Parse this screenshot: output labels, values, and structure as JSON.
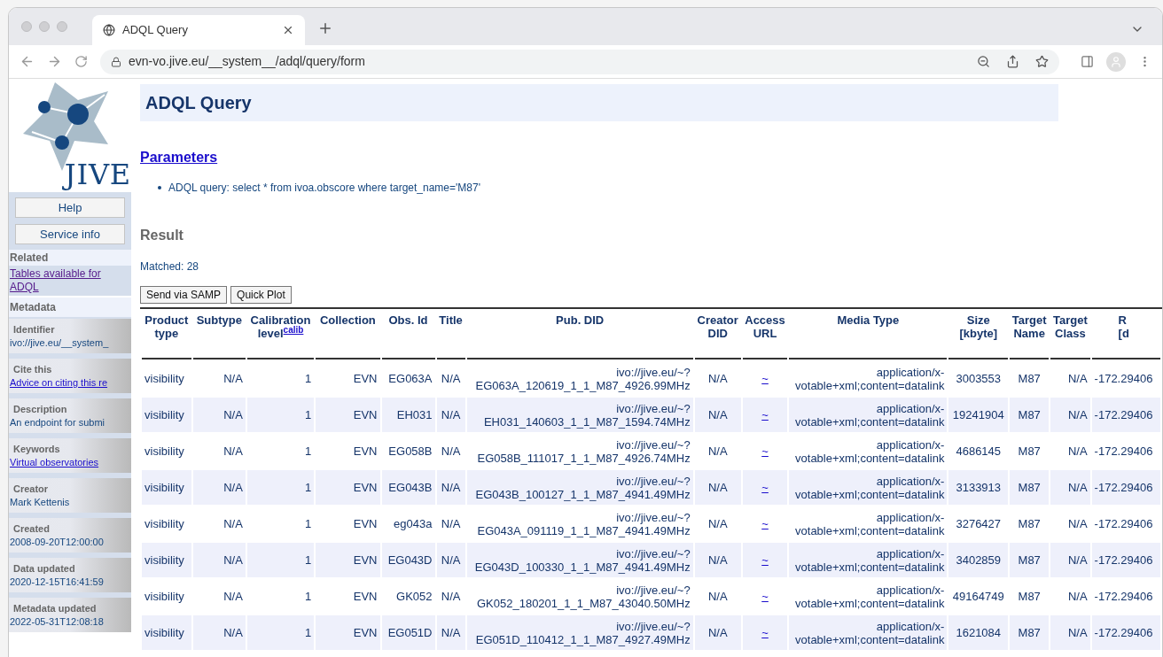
{
  "browser": {
    "tab_title": "ADQL Query",
    "url": "evn-vo.jive.eu/__system__/adql/query/form"
  },
  "sidebar": {
    "logo_text": "JIVE",
    "buttons": [
      "Help",
      "Service info"
    ],
    "related": {
      "heading": "Related",
      "links": [
        "Tables available for ADQL"
      ]
    },
    "metadata": {
      "heading": "Metadata",
      "items": [
        {
          "label": "Identifier",
          "value": "ivo://jive.eu/__system_",
          "kind": "text"
        },
        {
          "label": "Cite this",
          "value": "Advice on citing this re",
          "kind": "link"
        },
        {
          "label": "Description",
          "value": "An endpoint for submi",
          "kind": "text"
        },
        {
          "label": "Keywords",
          "value": "Virtual observatories",
          "kind": "link"
        },
        {
          "label": "Creator",
          "value": "Mark Kettenis",
          "kind": "text"
        },
        {
          "label": "Created",
          "value": "2008-09-20T12:00:00",
          "kind": "text"
        },
        {
          "label": "Data updated",
          "value": "2020-12-15T16:41:59",
          "kind": "text"
        },
        {
          "label": "Metadata updated",
          "value": "2022-05-31T12:08:18",
          "kind": "text"
        }
      ]
    }
  },
  "main": {
    "title": "ADQL Query",
    "parameters": {
      "heading": "Parameters",
      "items": [
        "ADQL query: select * from ivoa.obscore where target_name='M87'"
      ]
    },
    "result": {
      "heading": "Result",
      "matched": "Matched: 28",
      "buttons": [
        "Send via SAMP",
        "Quick Plot"
      ]
    },
    "table": {
      "columns": [
        {
          "lines": [
            "Product",
            "type"
          ]
        },
        {
          "lines": [
            "Subtype"
          ]
        },
        {
          "lines": [
            "Calibration",
            "level"
          ],
          "note": "calib"
        },
        {
          "lines": [
            "Collection"
          ]
        },
        {
          "lines": [
            "Obs. Id"
          ]
        },
        {
          "lines": [
            "Title"
          ]
        },
        {
          "lines": [
            "Pub. DID"
          ]
        },
        {
          "lines": [
            "Creator",
            "DID"
          ]
        },
        {
          "lines": [
            "Access",
            "URL"
          ]
        },
        {
          "lines": [
            "Media Type"
          ]
        },
        {
          "lines": [
            "Size",
            "[kbyte]"
          ]
        },
        {
          "lines": [
            "Target",
            "Name"
          ]
        },
        {
          "lines": [
            "Target",
            "Class"
          ]
        },
        {
          "lines": [
            "R",
            "[d"
          ]
        }
      ],
      "rows": [
        [
          "visibility",
          "N/A",
          "1",
          "EVN",
          "EG063A",
          "N/A",
          [
            "ivo://jive.eu/~?",
            "EG063A_120619_1_1_M87_4926.99MHz"
          ],
          "N/A",
          "~",
          "application/x-votable+xml;content=datalink",
          "3003553",
          "M87",
          "N/A",
          "-172.29406"
        ],
        [
          "visibility",
          "N/A",
          "1",
          "EVN",
          "EH031",
          "N/A",
          [
            "ivo://jive.eu/~?",
            "EH031_140603_1_1_M87_1594.74MHz"
          ],
          "N/A",
          "~",
          "application/x-votable+xml;content=datalink",
          "19241904",
          "M87",
          "N/A",
          "-172.29406"
        ],
        [
          "visibility",
          "N/A",
          "1",
          "EVN",
          "EG058B",
          "N/A",
          [
            "ivo://jive.eu/~?",
            "EG058B_111017_1_1_M87_4926.74MHz"
          ],
          "N/A",
          "~",
          "application/x-votable+xml;content=datalink",
          "4686145",
          "M87",
          "N/A",
          "-172.29406"
        ],
        [
          "visibility",
          "N/A",
          "1",
          "EVN",
          "EG043B",
          "N/A",
          [
            "ivo://jive.eu/~?",
            "EG043B_100127_1_1_M87_4941.49MHz"
          ],
          "N/A",
          "~",
          "application/x-votable+xml;content=datalink",
          "3133913",
          "M87",
          "N/A",
          "-172.29406"
        ],
        [
          "visibility",
          "N/A",
          "1",
          "EVN",
          "eg043a",
          "N/A",
          [
            "ivo://jive.eu/~?",
            "EG043A_091119_1_1_M87_4941.49MHz"
          ],
          "N/A",
          "~",
          "application/x-votable+xml;content=datalink",
          "3276427",
          "M87",
          "N/A",
          "-172.29406"
        ],
        [
          "visibility",
          "N/A",
          "1",
          "EVN",
          "EG043D",
          "N/A",
          [
            "ivo://jive.eu/~?",
            "EG043D_100330_1_1_M87_4941.49MHz"
          ],
          "N/A",
          "~",
          "application/x-votable+xml;content=datalink",
          "3402859",
          "M87",
          "N/A",
          "-172.29406"
        ],
        [
          "visibility",
          "N/A",
          "1",
          "EVN",
          "GK052",
          "N/A",
          [
            "ivo://jive.eu/~?",
            "GK052_180201_1_1_M87_43040.50MHz"
          ],
          "N/A",
          "~",
          "application/x-votable+xml;content=datalink",
          "49164749",
          "M87",
          "N/A",
          "-172.29406"
        ],
        [
          "visibility",
          "N/A",
          "1",
          "EVN",
          "EG051D",
          "N/A",
          [
            "ivo://jive.eu/~?",
            "EG051D_110412_1_1_M87_4927.49MHz"
          ],
          "N/A",
          "~",
          "application/x-votable+xml;content=datalink",
          "1621084",
          "M87",
          "N/A",
          "-172.29406"
        ]
      ]
    }
  }
}
